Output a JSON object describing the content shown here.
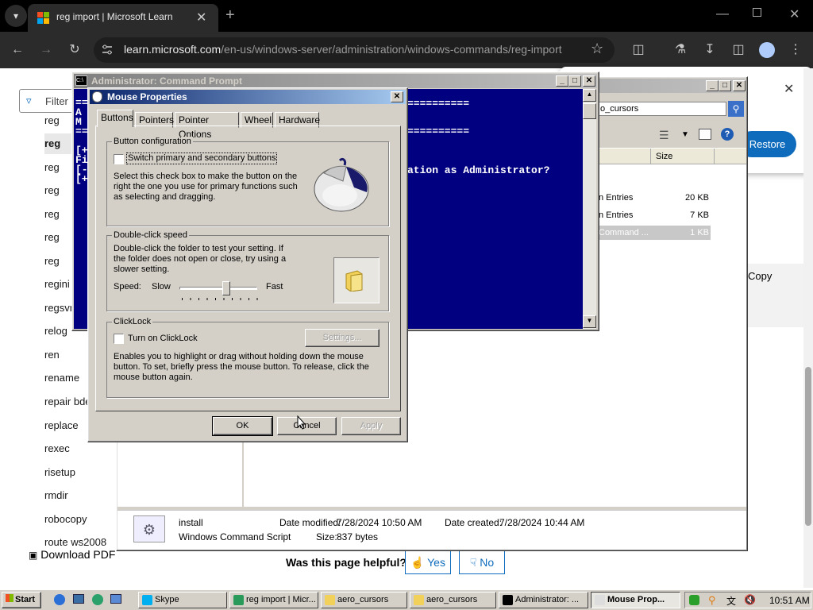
{
  "browser": {
    "tab_title": "reg import | Microsoft Learn",
    "url_host": "learn.microsoft.com",
    "url_path": "/en-us/windows-server/administration/windows-commands/reg-import"
  },
  "page": {
    "filter_label": "Filter",
    "nav_items": [
      "reg",
      "reg",
      "reg",
      "reg",
      "reg",
      "reg",
      "reg",
      "regini",
      "regsvr32",
      "relog",
      "ren",
      "rename",
      "repair bde",
      "replace",
      "rexec",
      "risetup",
      "rmdir",
      "robocopy",
      "route ws2008"
    ],
    "download_pdf": "Download PDF",
    "helpful_question": "Was this page helpful?",
    "yes_label": "Yes",
    "no_label": "No",
    "restore_label": "Restore",
    "copy_label": "Copy"
  },
  "cmd": {
    "title": "Administrator:  Command Prompt",
    "lines_left": [
      "==",
      "A",
      "M",
      "==",
      "",
      "[+",
      "Fi",
      "[-",
      "[+"
    ],
    "sep1": "==========",
    "sep2": "==========",
    "question": "ation as Administrator?"
  },
  "explorer": {
    "search_text": "o_cursors",
    "col_size": "Size",
    "rows": [
      {
        "name": "n Entries",
        "size": "20 KB"
      },
      {
        "name": "n Entries",
        "size": "7 KB"
      },
      {
        "name": "Command ...",
        "size": "1 KB"
      }
    ],
    "details": {
      "name": "install",
      "type": "Windows Command Script",
      "modified_label": "Date modified:",
      "modified_value": "7/28/2024 10:50 AM",
      "created_label": "Date created:",
      "created_value": "7/28/2024 10:44 AM",
      "size_label": "Size:",
      "size_value": "837 bytes"
    }
  },
  "mouse": {
    "title": "Mouse Properties",
    "tabs": [
      "Buttons",
      "Pointers",
      "Pointer Options",
      "Wheel",
      "Hardware"
    ],
    "button_config_label": "Button configuration",
    "switch_label": "Switch primary and secondary buttons",
    "switch_desc": "Select this check box to make the button on the right the one you use for primary functions such as selecting and dragging.",
    "dblclick_label": "Double-click speed",
    "dblclick_desc": "Double-click the folder to test your setting. If the folder does not open or close, try using a slower setting.",
    "speed_label": "Speed:",
    "slow_label": "Slow",
    "fast_label": "Fast",
    "speed_value": 0.6,
    "clicklock_label": "ClickLock",
    "clicklock_check": "Turn on ClickLock",
    "settings_btn": "Settings...",
    "clicklock_desc": "Enables you to highlight or drag without holding down the mouse button. To set, briefly press the mouse button. To release, click the mouse button again.",
    "ok": "OK",
    "cancel": "Cancel",
    "apply": "Apply"
  },
  "taskbar": {
    "start": "Start",
    "buttons": [
      "Skype",
      "reg import | Micr...",
      "aero_cursors",
      "aero_cursors",
      "Administrator: ...",
      "Mouse Prop..."
    ],
    "clock": "10:51 AM"
  },
  "colors": {
    "cmd_bg": "#000080",
    "caption_active": "#0a246a",
    "restore_btn": "#0f6cbd"
  }
}
